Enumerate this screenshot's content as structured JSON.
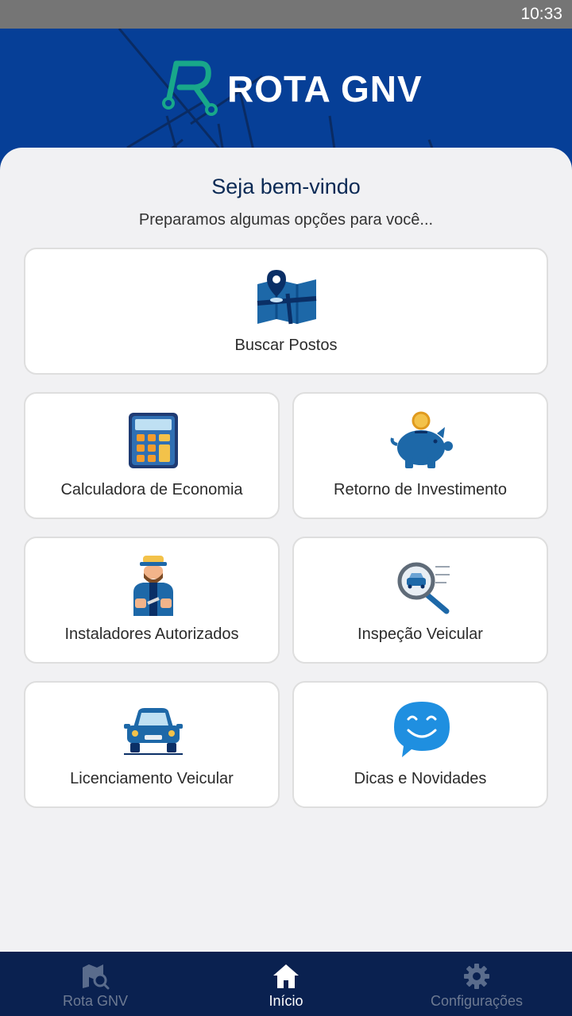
{
  "status_bar": {
    "time": "10:33"
  },
  "header": {
    "brand": "ROTA GNV"
  },
  "main": {
    "title": "Seja bem-vindo",
    "subtitle": "Preparamos algumas opções para você...",
    "cards": [
      {
        "label": "Buscar Postos",
        "icon": "map-pin-icon"
      },
      {
        "label": "Calculadora de Economia",
        "icon": "calculator-icon"
      },
      {
        "label": "Retorno de Investimento",
        "icon": "piggy-bank-icon"
      },
      {
        "label": "Instaladores Autorizados",
        "icon": "mechanic-icon"
      },
      {
        "label": "Inspeção Veicular",
        "icon": "car-inspection-icon"
      },
      {
        "label": "Licenciamento Veicular",
        "icon": "car-icon"
      },
      {
        "label": "Dicas e Novidades",
        "icon": "smile-chat-icon"
      }
    ]
  },
  "bottom_nav": {
    "items": [
      {
        "label": "Rota GNV",
        "icon": "map-search-icon",
        "active": false
      },
      {
        "label": "Início",
        "icon": "home-icon",
        "active": true
      },
      {
        "label": "Configurações",
        "icon": "gear-icon",
        "active": false
      }
    ]
  },
  "colors": {
    "header_blue": "#063f97",
    "nav_bg": "#0a2150",
    "logo_green": "#18a88a",
    "icon_blue": "#1d68a8"
  }
}
